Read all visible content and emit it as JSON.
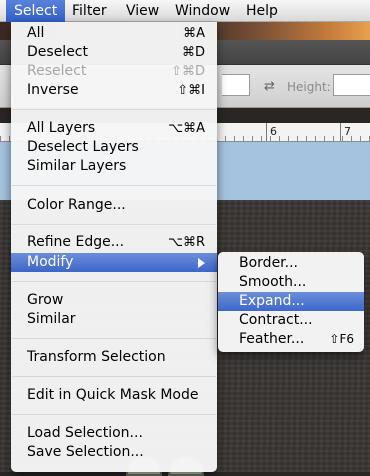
{
  "menubar": {
    "items": [
      {
        "label": "Select",
        "active": true
      },
      {
        "label": "Filter"
      },
      {
        "label": "View"
      },
      {
        "label": "Window"
      },
      {
        "label": "Help"
      }
    ]
  },
  "toolbar": {
    "height_label": "Height:",
    "swap_icon": "⇄"
  },
  "ruler": {
    "labels": [
      "6",
      "7"
    ]
  },
  "select_menu": {
    "items": [
      {
        "label": "All",
        "shortcut": "⌘A"
      },
      {
        "label": "Deselect",
        "shortcut": "⌘D"
      },
      {
        "label": "Reselect",
        "shortcut": "⇧⌘D",
        "disabled": true
      },
      {
        "label": "Inverse",
        "shortcut": "⇧⌘I"
      },
      {
        "label": "All Layers",
        "shortcut": "⌥⌘A"
      },
      {
        "label": "Deselect Layers",
        "shortcut": ""
      },
      {
        "label": "Similar Layers",
        "shortcut": ""
      },
      {
        "label": "Color Range...",
        "shortcut": ""
      },
      {
        "label": "Refine Edge...",
        "shortcut": "⌥⌘R"
      },
      {
        "label": "Modify",
        "shortcut": "",
        "highlighted": true,
        "submenu": true
      },
      {
        "label": "Grow",
        "shortcut": ""
      },
      {
        "label": "Similar",
        "shortcut": ""
      },
      {
        "label": "Transform Selection",
        "shortcut": ""
      },
      {
        "label": "Edit in Quick Mask Mode",
        "shortcut": ""
      },
      {
        "label": "Load Selection...",
        "shortcut": ""
      },
      {
        "label": "Save Selection...",
        "shortcut": ""
      }
    ]
  },
  "modify_submenu": {
    "items": [
      {
        "label": "Border...",
        "shortcut": ""
      },
      {
        "label": "Smooth...",
        "shortcut": ""
      },
      {
        "label": "Expand...",
        "shortcut": "",
        "highlighted": true
      },
      {
        "label": "Contract...",
        "shortcut": ""
      },
      {
        "label": "Feather...",
        "shortcut": "⇧F6"
      }
    ]
  },
  "colors": {
    "highlight": "#3c66c9",
    "disabled_text": "#a6a6a6"
  }
}
